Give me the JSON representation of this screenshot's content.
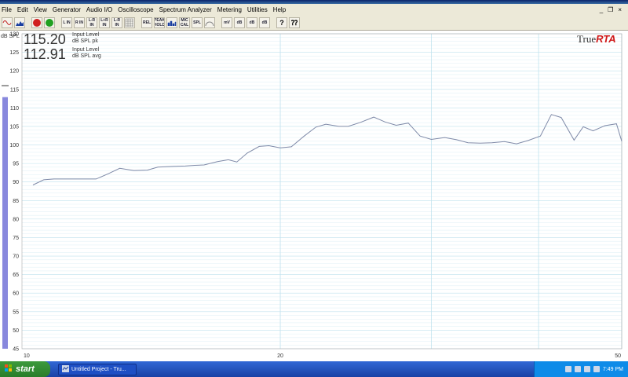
{
  "menubar": {
    "items": [
      "File",
      "Edit",
      "View",
      "Generator",
      "Audio I/O",
      "Oscilloscope",
      "Spectrum Analyzer",
      "Metering",
      "Utilities",
      "Help"
    ]
  },
  "toolbar": {
    "buttons": [
      "sine",
      "spectrum",
      "stop",
      "go",
      "L IN",
      "R IN",
      "L-R IN",
      "L+R IN",
      "L-R IN",
      "grid",
      "REL",
      "PEAK HOLD",
      "bars",
      "MIC CAL",
      "SPL",
      "dial",
      "mV",
      "dB",
      "dB",
      "dB",
      "help",
      "whats-this"
    ]
  },
  "readouts": [
    {
      "value": "115.20",
      "label1": "Input Level",
      "label2": "dB SPL pk"
    },
    {
      "value": "112.91",
      "label1": "Input Level",
      "label2": "dB SPL avg"
    }
  ],
  "brand": {
    "part1": "True",
    "part2": "RTA"
  },
  "chart_data": {
    "type": "line",
    "ylabel": "dB SPL",
    "ylim": [
      45,
      130
    ],
    "xlim": [
      10,
      50
    ],
    "xscale": "log",
    "yticks": [
      130,
      125,
      120,
      115,
      110,
      105,
      100,
      95,
      90,
      85,
      80,
      75,
      70,
      65,
      60,
      55,
      50,
      45
    ],
    "xtick_labels": [
      "10",
      "20",
      "50"
    ],
    "grid": true,
    "level_bar": {
      "top": 112.91,
      "bottom": 45,
      "color": "#8888dd"
    },
    "series": [
      {
        "color": "#7f8aa8",
        "x": [
          10.3,
          10.6,
          10.9,
          11.2,
          11.6,
          12.2,
          12.6,
          13.0,
          13.5,
          14.0,
          14.4,
          15.0,
          15.5,
          15.9,
          16.3,
          16.9,
          17.4,
          17.8,
          18.3,
          18.9,
          19.4,
          20.0,
          20.6,
          21.3,
          22.0,
          22.6,
          23.4,
          24.0,
          24.8,
          25.7,
          26.5,
          27.3,
          28.2,
          29.1,
          30.0,
          31.1,
          32.1,
          33.1,
          34.2,
          35.3,
          36.5,
          37.7,
          38.9,
          40.2,
          41.4,
          42.5,
          44.0,
          45.1,
          46.3,
          47.8,
          49.3,
          50.0
        ],
        "y": [
          89.2,
          90.6,
          90.8,
          90.8,
          90.8,
          90.8,
          92.2,
          93.7,
          93.1,
          93.2,
          94.0,
          94.2,
          94.3,
          94.5,
          94.6,
          95.5,
          96.0,
          95.4,
          97.8,
          99.6,
          99.8,
          99.2,
          99.5,
          102.3,
          104.8,
          105.6,
          105.0,
          105.0,
          106.1,
          107.5,
          106.2,
          105.3,
          105.9,
          102.4,
          101.5,
          102.0,
          101.4,
          100.6,
          100.5,
          100.6,
          100.9,
          100.3,
          101.2,
          102.4,
          108.2,
          107.4,
          101.3,
          104.9,
          103.8,
          105.2,
          105.7,
          101.0
        ]
      }
    ]
  },
  "taskbar": {
    "start_label": "start",
    "task_label": "Untitled Project - Tru...",
    "clock": "7:49 PM"
  }
}
